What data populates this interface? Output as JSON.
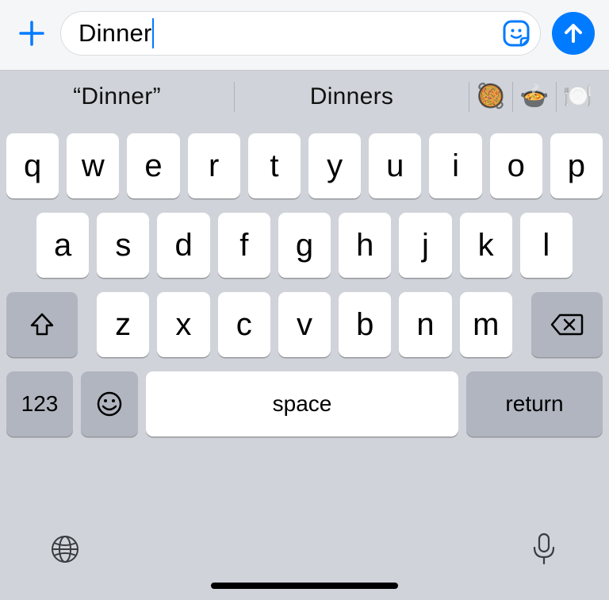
{
  "compose": {
    "plus_icon": "plus",
    "text": "Dinner",
    "sticker_icon": "sticker-smile",
    "send_icon": "send-arrow"
  },
  "suggestions": {
    "quoted": "“Dinner”",
    "plural": "Dinners",
    "emoji1": "🥘",
    "emoji2": "🍲",
    "emoji3": "🍽️"
  },
  "keyboard": {
    "row1": [
      "q",
      "w",
      "e",
      "r",
      "t",
      "y",
      "u",
      "i",
      "o",
      "p"
    ],
    "row2": [
      "a",
      "s",
      "d",
      "f",
      "g",
      "h",
      "j",
      "k",
      "l"
    ],
    "row3": [
      "z",
      "x",
      "c",
      "v",
      "b",
      "n",
      "m"
    ],
    "shift_icon": "shift",
    "delete_icon": "backspace",
    "numbers_label": "123",
    "emoji_icon": "emoji-face",
    "space_label": "space",
    "return_label": "return"
  },
  "bottom": {
    "globe_icon": "globe",
    "mic_icon": "mic"
  },
  "colors": {
    "accent": "#007aff",
    "key_bg": "#ffffff",
    "key_mod_bg": "#b0b5bf",
    "kb_bg": "#d0d3d9"
  }
}
